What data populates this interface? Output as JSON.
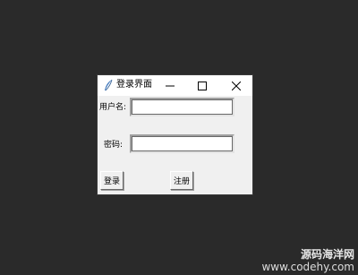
{
  "window": {
    "title": "登录界面",
    "app_icon": "feather-icon",
    "controls": {
      "minimize_icon": "minimize-icon",
      "maximize_icon": "maximize-icon",
      "close_icon": "close-icon"
    }
  },
  "form": {
    "username_label": "用户名:",
    "username_value": "",
    "password_label": "密码:",
    "password_value": ""
  },
  "buttons": {
    "login_label": "登录",
    "register_label": "注册"
  },
  "watermark": {
    "line1": "源码海洋网",
    "line2": "www.codehy.com"
  },
  "colors": {
    "desktop_bg": "#2a2a2a",
    "window_bg": "#f0f0f0",
    "titlebar_bg": "#ffffff",
    "icon_accent": "#4a7fc0"
  }
}
